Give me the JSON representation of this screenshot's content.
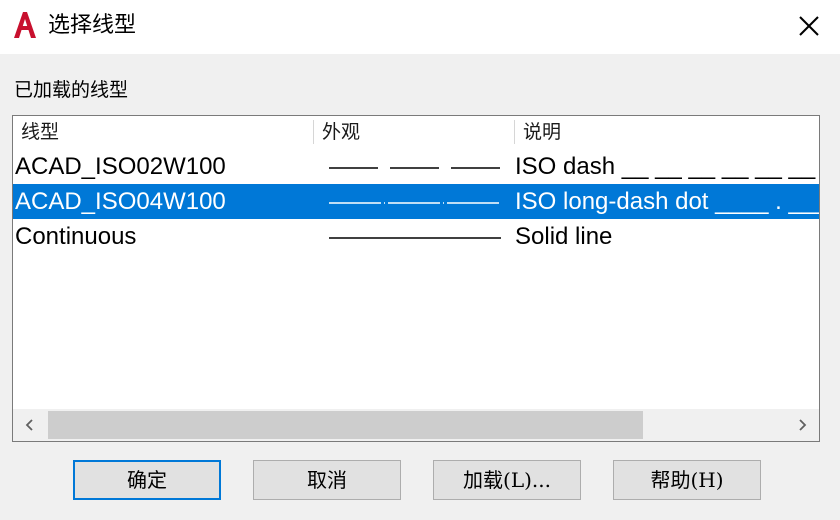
{
  "window": {
    "title": "选择线型"
  },
  "section_label": "已加载的线型",
  "table": {
    "columns": [
      "线型",
      "外观",
      "说明"
    ],
    "rows": [
      {
        "name": "ACAD_ISO02W100",
        "pattern": "dash",
        "description": "ISO dash __ __ __ __ __ __ __ __",
        "selected": false
      },
      {
        "name": "ACAD_ISO04W100",
        "pattern": "long-dash-dot",
        "description": "ISO long-dash dot ____ . ____",
        "selected": true
      },
      {
        "name": "Continuous",
        "pattern": "solid",
        "description": "Solid line",
        "selected": false
      }
    ]
  },
  "buttons": {
    "ok": "确定",
    "cancel": "取消",
    "load": "加载(L)...",
    "help": "帮助(H)"
  },
  "colors": {
    "selection": "#0078d7",
    "logo": "#c8102e",
    "background": "#f0f0f0"
  },
  "icons": {
    "logo": "autocad-logo-icon",
    "close": "close-icon",
    "scroll_left": "chevron-left-icon",
    "scroll_right": "chevron-right-icon"
  }
}
